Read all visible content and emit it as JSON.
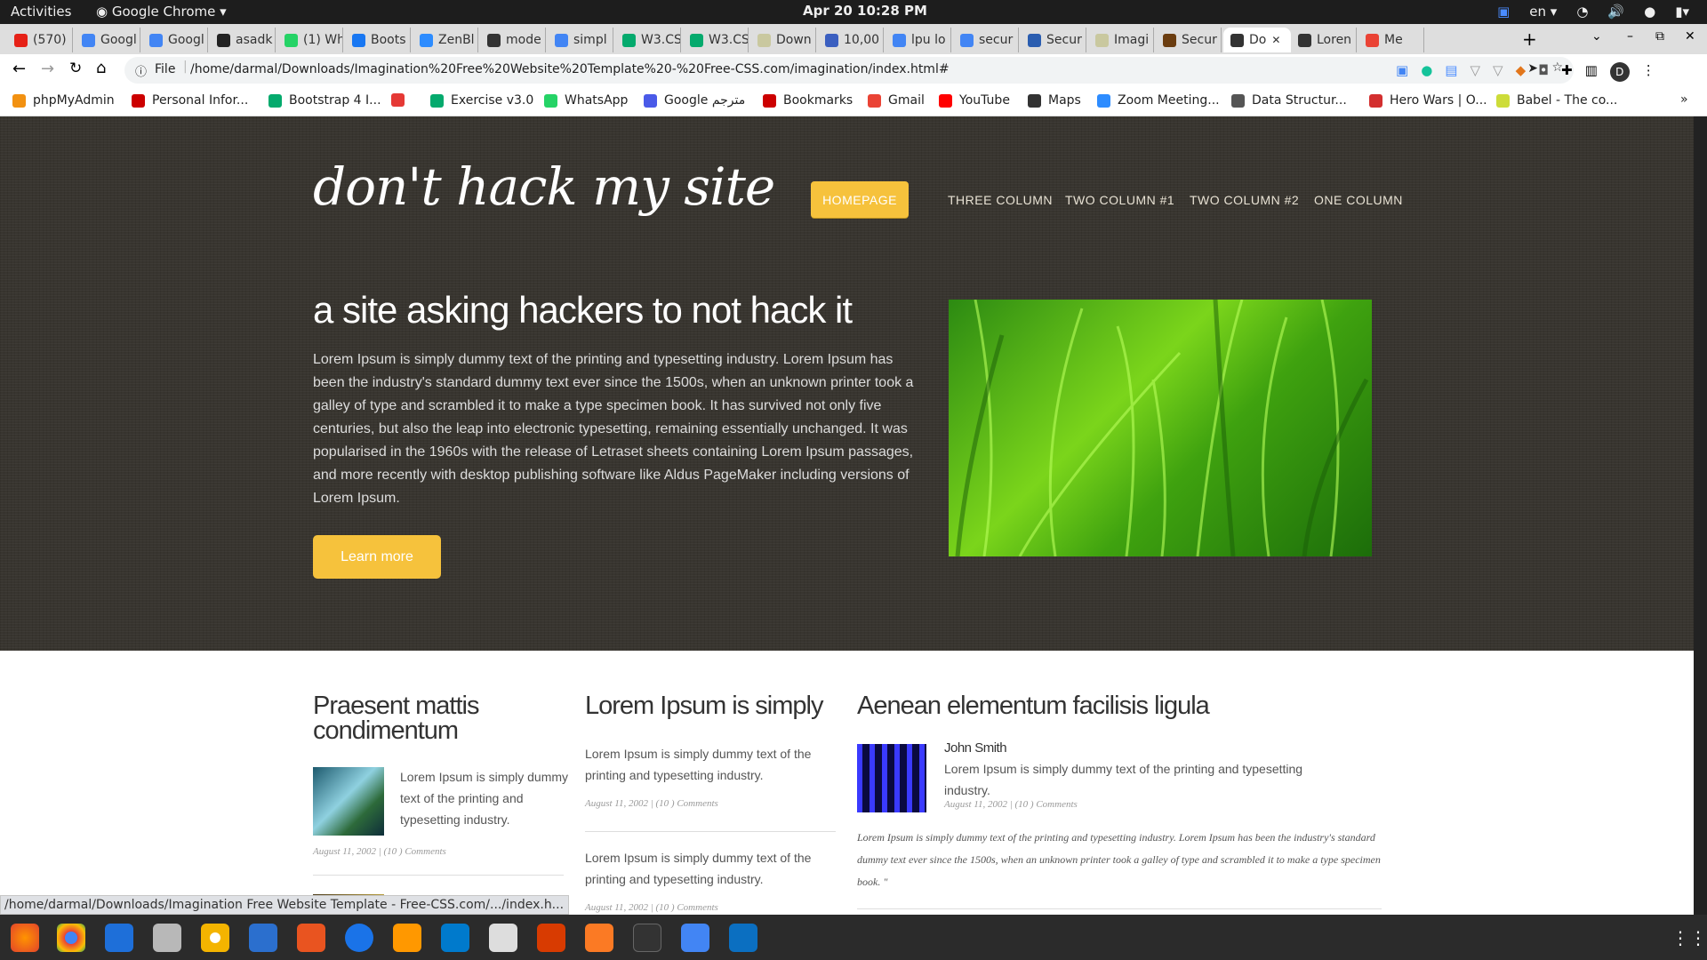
{
  "gnome": {
    "activities": "Activities",
    "app": "Google Chrome",
    "clock": "Apr 20  10:28 PM",
    "lang": "en"
  },
  "tabs": [
    {
      "label": "(570)",
      "color": "#e62117"
    },
    {
      "label": "Googl",
      "color": "#4285f4"
    },
    {
      "label": "Googl",
      "color": "#4285f4"
    },
    {
      "label": "asadk",
      "color": "#222"
    },
    {
      "label": "(1) Wh",
      "color": "#25d366"
    },
    {
      "label": "Boots",
      "color": "#1877f2"
    },
    {
      "label": "ZenBl",
      "color": "#2d8cff"
    },
    {
      "label": "mode",
      "color": "#333"
    },
    {
      "label": "simpl",
      "color": "#4285f4"
    },
    {
      "label": "W3.CS",
      "color": "#04aa6d"
    },
    {
      "label": "W3.CS",
      "color": "#04aa6d"
    },
    {
      "label": "Down",
      "color": "#c9c89f"
    },
    {
      "label": "10,00",
      "color": "#3b5fc0"
    },
    {
      "label": "lpu lo",
      "color": "#4285f4"
    },
    {
      "label": "secur",
      "color": "#4285f4"
    },
    {
      "label": "Secur",
      "color": "#2a5db0"
    },
    {
      "label": "Imagi",
      "color": "#c9c89f"
    },
    {
      "label": "Secur",
      "color": "#6b3d10"
    },
    {
      "label": "Do",
      "color": "#333"
    },
    {
      "label": "Loren",
      "color": "#333"
    },
    {
      "label": "Me",
      "color": "#ea4335"
    }
  ],
  "address": {
    "scheme": "File",
    "url": "/home/darmal/Downloads/Imagination%20Free%20Website%20Template%20-%20Free-CSS.com/imagination/index.html#"
  },
  "bookmarks": [
    "phpMyAdmin",
    "Personal Infor...",
    "Bootstrap 4 I...",
    "",
    "Exercise v3.0",
    "WhatsApp",
    "Google مترجم",
    "Bookmarks",
    "Gmail",
    "YouTube",
    "Maps",
    "Zoom Meeting...",
    "Data Structur...",
    "Hero Wars | O...",
    "Babel - The co..."
  ],
  "site": {
    "logo": "don't hack my site",
    "nav": [
      "HOMEPAGE",
      "THREE COLUMN",
      "TWO COLUMN #1",
      "TWO COLUMN #2",
      "ONE COLUMN"
    ],
    "hero_title": "a site asking hackers to not hack it",
    "hero_text": "Lorem Ipsum is simply dummy text of the printing and typesetting industry. Lorem Ipsum has been the industry's standard dummy text ever since the 1500s, when an unknown printer took a galley of type and scrambled it to make a type specimen book. It has survived not only five centuries, but also the leap into electronic typesetting, remaining essentially unchanged. It was popularised in the 1960s with the release of Letraset sheets containing Lorem Ipsum passages, and more recently with desktop publishing software like Aldus PageMaker including versions of Lorem Ipsum.",
    "learn_more": "Learn more",
    "col1": {
      "title": "Praesent mattis condimentum",
      "text": "Lorem Ipsum is simply dummy text of the printing and typesetting industry.",
      "meta": "August 11, 2002 | (10 ) Comments"
    },
    "col2": {
      "title": "Lorem Ipsum is simply",
      "item1": "Lorem Ipsum is simply dummy text of the printing and typesetting industry.",
      "meta1": "August 11, 2002 | (10 ) Comments",
      "item2": "Lorem Ipsum is simply dummy text of the printing and typesetting industry.",
      "meta2": "August 11, 2002 | (10 ) Comments"
    },
    "col3": {
      "title": "Aenean elementum facilisis ligula",
      "author": "John Smith",
      "text": "Lorem Ipsum is simply dummy text of the printing and typesetting industry.",
      "meta": "August 11, 2002 | (10 ) Comments",
      "quote": "Lorem Ipsum is simply dummy text of the printing and typesetting industry. Lorem Ipsum has been the industry's standard dummy text ever since the 1500s, when an unknown printer took a galley of type and scrambled it to make a type specimen book. \""
    }
  },
  "status_url": "/home/darmal/Downloads/Imagination Free Website Template - Free-CSS.com/.../index.h..."
}
